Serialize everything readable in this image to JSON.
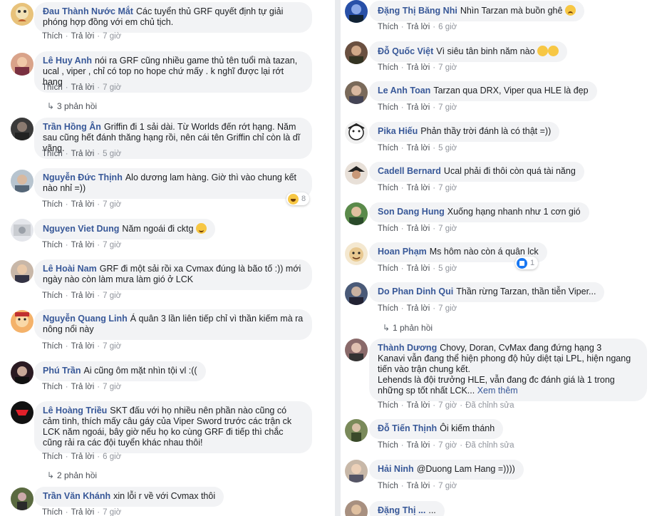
{
  "actions": {
    "like": "Thích",
    "reply": "Trả lời",
    "edited": "Đã chỉnh sửa"
  },
  "left": [
    {
      "name": "Đau Thành Nước Mắt",
      "text": "Các tuyển thủ GRF quyết định tự giải phóng hợp đồng với em chủ tịch.",
      "time": "7 giờ"
    },
    {
      "name": "Lê Huy Anh",
      "text": "nói ra GRF cũng nhiều game thủ tên tuổi mà tazan, ucal , viper , chỉ có top no hope chứ mấy . k nghĩ được lại rớt hạng",
      "time": "7 giờ",
      "replies": "3 phản hồi"
    },
    {
      "name": "Trần Hồng Ân",
      "text": "Griffin đi 1 sải dài. Từ Worlds đến rớt hạng. Năm sau cũng hết đánh thăng hạng rồi, nên cái tên Griffin chỉ còn là dĩ vãng.",
      "time": "5 giờ"
    },
    {
      "name": "Nguyễn Đức Thịnh",
      "text": "Alo dương lam hàng. Giờ thì vào chung kết nào nhỉ =))",
      "time": "7 giờ",
      "reaction_count": "8"
    },
    {
      "name": "Nguyen Viet Dung",
      "text": "Năm ngoái đi cktg",
      "time": "7 giờ"
    },
    {
      "name": "Lê Hoài Nam",
      "text": "GRF đi một sải rồi xa Cvmax đúng là bão tố :)) mới ngày nào còn làm mưa làm gió ở LCK",
      "time": "7 giờ"
    },
    {
      "name": "Nguyễn Quang Linh",
      "text": "Á quân 3 lần liên tiếp chỉ vì thần kiếm mà ra nông nổi này",
      "time": "7 giờ"
    },
    {
      "name": "Phú Trần",
      "text": "Ai cũng ôm mặt nhìn tội vl :((",
      "time": "7 giờ"
    },
    {
      "name": "Lê Hoàng Triều",
      "text": "SKT đấu với họ nhiều nên phần nào cũng có cảm tình, thích mấy câu gáy của Viper Sword trước các trận ck LCK năm ngoái, bây giờ nếu họ ko cùng GRF đi tiếp thì chắc cũng rải ra các đội tuyển khác nhau thôi!",
      "time": "6 giờ",
      "replies": "2 phản hồi"
    },
    {
      "name": "Trần Văn Khánh",
      "text": "xin lỗi r về với Cvmax thôi",
      "time": "7 giờ"
    }
  ],
  "right": [
    {
      "name": "Đặng Thị Băng Nhi",
      "text": "Nhìn Tarzan mà buồn ghê",
      "time": "6 giờ"
    },
    {
      "name": "Đỗ Quốc Việt",
      "text": "Vì siêu tân binh năm nào",
      "time": "7 giờ"
    },
    {
      "name": "Le Anh Toan",
      "text": "Tarzan qua DRX, Viper qua HLE là đẹp",
      "time": "7 giờ"
    },
    {
      "name": "Pika Hiếu",
      "text": "Phản thầy trời đánh là có thật =))",
      "time": "5 giờ"
    },
    {
      "name": "Cadell Bernard",
      "text": "Ucal phải đi thôi còn quá tài năng",
      "time": "7 giờ"
    },
    {
      "name": "Son Dang Hung",
      "text": "Xuống hạng nhanh như 1 cơn gió",
      "time": "7 giờ"
    },
    {
      "name": "Hoan Phạm",
      "text": "Ms hôm nào còn á quân lck",
      "time": "5 giờ",
      "reaction_count": "1"
    },
    {
      "name": "Do Phan Dinh Qui",
      "text": "Thần rừng Tarzan, thần tiễn Viper...",
      "time": "7 giờ",
      "replies": "1 phản hồi"
    },
    {
      "name": "Thành Dương",
      "text": "Chovy, Doran, CvMax đang đứng hạng 3",
      "text2": "Kanavi vẫn đang thể hiện phong độ hủy diệt tại LPL, hiện ngang tiến vào trận chung kết.",
      "text3": "Lehends là đội trưởng HLE, vẫn đang đc đánh giá là 1 trong những sp tốt nhất LCK...",
      "see_more": "Xem thêm",
      "time": "7 giờ",
      "edited": true
    },
    {
      "name": "Đỗ Tiến Thịnh",
      "text": "Ôi kiếm thánh",
      "time": "7 giờ",
      "edited": true
    },
    {
      "name": "Hải Ninh",
      "text": "@Duong Lam Hang =))))",
      "time": "7 giờ"
    }
  ],
  "partial_bottom": {
    "name": "Đặng Thị ...",
    "time": "..."
  },
  "colors": {
    "author": "#385898",
    "bubble": "#f2f3f5",
    "meta": "#90949c",
    "like_blue": "#1877f2"
  }
}
